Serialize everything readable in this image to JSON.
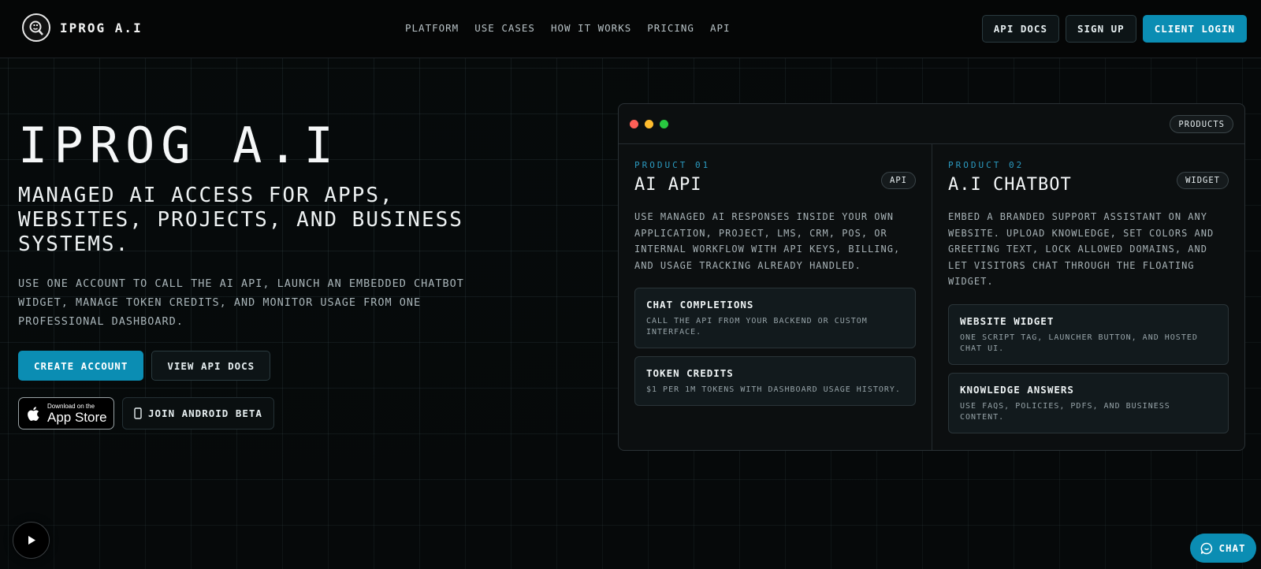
{
  "brand": {
    "name": "IPROG A.I"
  },
  "nav": [
    {
      "label": "PLATFORM"
    },
    {
      "label": "USE CASES"
    },
    {
      "label": "HOW IT WORKS"
    },
    {
      "label": "PRICING"
    },
    {
      "label": "API"
    }
  ],
  "header_buttons": {
    "api_docs": "API DOCS",
    "sign_up": "SIGN UP",
    "client_login": "CLIENT LOGIN"
  },
  "hero": {
    "title": "IPROG A.I",
    "subtitle": "MANAGED AI ACCESS FOR APPS, WEBSITES, PROJECTS, AND BUSINESS SYSTEMS.",
    "description": "USE ONE ACCOUNT TO CALL THE AI API, LAUNCH AN EMBEDDED CHATBOT WIDGET, MANAGE TOKEN CREDITS, AND MONITOR USAGE FROM ONE PROFESSIONAL DASHBOARD.",
    "create_account": "CREATE ACCOUNT",
    "view_api_docs": "VIEW API DOCS",
    "appstore_small": "Download on the",
    "appstore_big": "App Store",
    "android": "JOIN ANDROID BETA"
  },
  "window": {
    "tag": "PRODUCTS",
    "dot_colors": [
      "#ff5f57",
      "#febc2e",
      "#28c840"
    ],
    "products": [
      {
        "kicker": "PRODUCT 01",
        "title": "AI API",
        "pill": "API",
        "description": "USE MANAGED AI RESPONSES INSIDE YOUR OWN APPLICATION, PROJECT, LMS, CRM, POS, OR INTERNAL WORKFLOW WITH API KEYS, BILLING, AND USAGE TRACKING ALREADY HANDLED.",
        "features": [
          {
            "title": "CHAT COMPLETIONS",
            "desc": "CALL THE API FROM YOUR BACKEND OR CUSTOM INTERFACE."
          },
          {
            "title": "TOKEN CREDITS",
            "desc": "$1 PER 1M TOKENS WITH DASHBOARD USAGE HISTORY."
          }
        ]
      },
      {
        "kicker": "PRODUCT 02",
        "title": "A.I CHATBOT",
        "pill": "WIDGET",
        "description": "EMBED A BRANDED SUPPORT ASSISTANT ON ANY WEBSITE. UPLOAD KNOWLEDGE, SET COLORS AND GREETING TEXT, LOCK ALLOWED DOMAINS, AND LET VISITORS CHAT THROUGH THE FLOATING WIDGET.",
        "features": [
          {
            "title": "WEBSITE WIDGET",
            "desc": "ONE SCRIPT TAG, LAUNCHER BUTTON, AND HOSTED CHAT UI."
          },
          {
            "title": "KNOWLEDGE ANSWERS",
            "desc": "USE FAQS, POLICIES, PDFS, AND BUSINESS CONTENT."
          }
        ]
      }
    ]
  },
  "chat_button": "CHAT",
  "colors": {
    "accent": "#0b8db3",
    "kicker": "#2b9ac0",
    "background": "#050708"
  }
}
